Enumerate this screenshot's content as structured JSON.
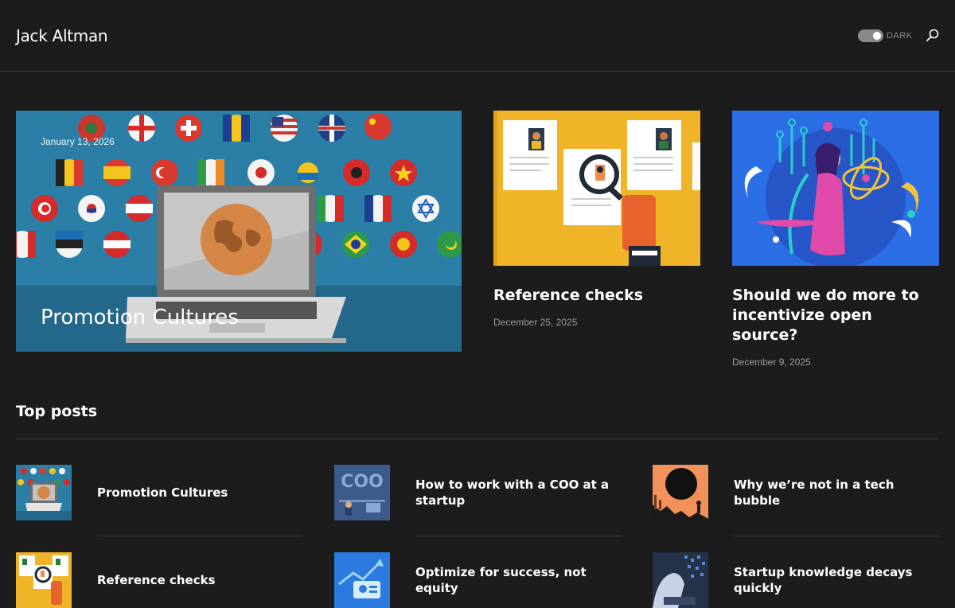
{
  "header": {
    "site_title": "Jack Altman",
    "theme_toggle_label": "DARK",
    "search_icon": "search-icon"
  },
  "featured": {
    "date": "January 13, 2026",
    "title": "Promotion Cultures"
  },
  "cards": [
    {
      "title": "Reference checks",
      "date": "December 25, 2025"
    },
    {
      "title": "Should we do more to incentivize open source?",
      "date": "December 9, 2025"
    }
  ],
  "top_posts": {
    "heading": "Top posts",
    "items": [
      {
        "title": "Promotion Cultures"
      },
      {
        "title": "How to work with a COO at a startup"
      },
      {
        "title": "Why we’re not in a tech bubble"
      },
      {
        "title": "Reference checks"
      },
      {
        "title": "Optimize for success, not equity"
      },
      {
        "title": "Startup knowledge decays quickly"
      }
    ]
  },
  "thumb_text": {
    "coo": "COO"
  },
  "colors": {
    "background": "#1c1c1c",
    "divider": "#3a3a3a",
    "hero_blue": "#2a7aa0",
    "reference_yellow": "#f0b429",
    "open_source_blue": "#2a6fe0",
    "bubble_orange": "#f2915a"
  }
}
